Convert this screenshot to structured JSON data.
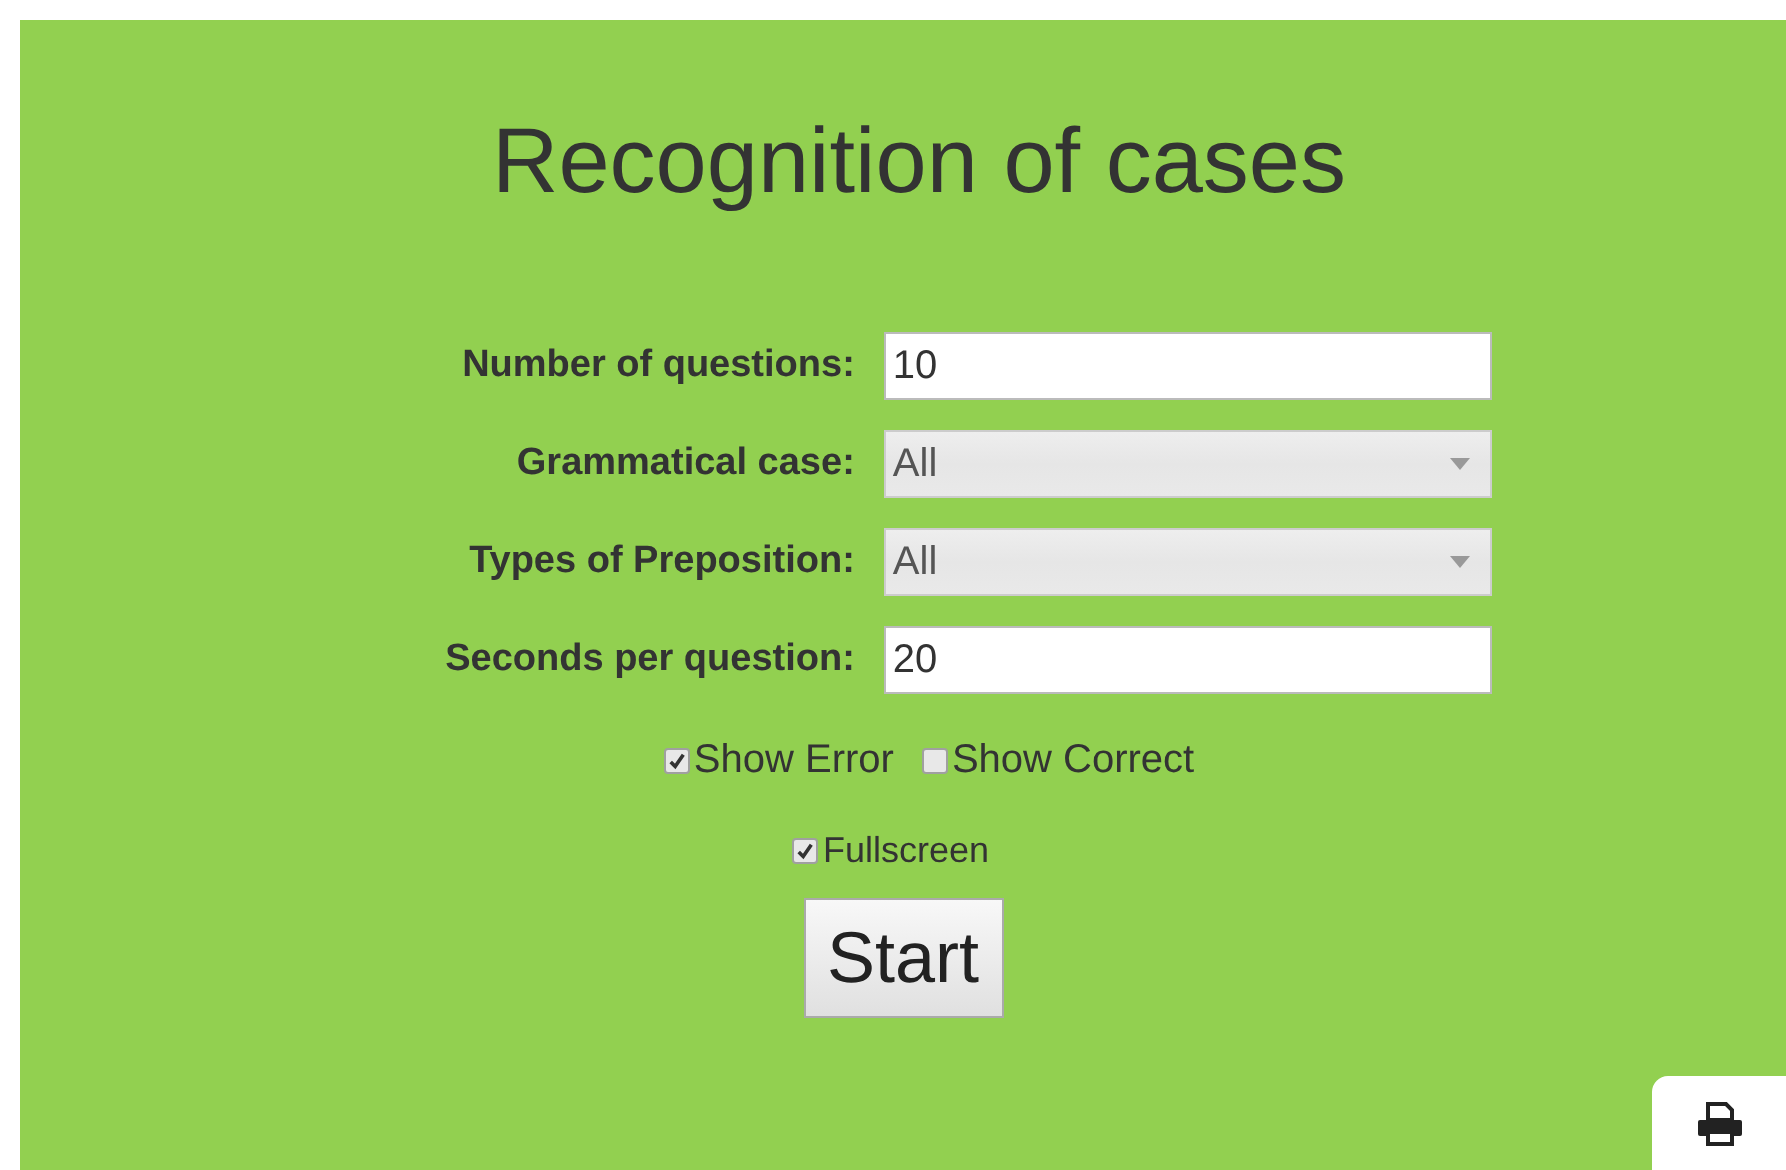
{
  "title": "Recognition of cases",
  "fields": [
    {
      "kind": "text",
      "label": "Number of questions:",
      "value": "10"
    },
    {
      "kind": "select",
      "label": "Grammatical case:",
      "value": "All"
    },
    {
      "kind": "select",
      "label": "Types of Preposition:",
      "value": "All"
    },
    {
      "kind": "text",
      "label": "Seconds per question:",
      "value": "20"
    }
  ],
  "options": [
    {
      "label": "Show Error",
      "checked": true
    },
    {
      "label": "Show Correct",
      "checked": false
    }
  ],
  "fullscreen": {
    "label": "Fullscreen",
    "checked": true
  },
  "start_button": "Start"
}
